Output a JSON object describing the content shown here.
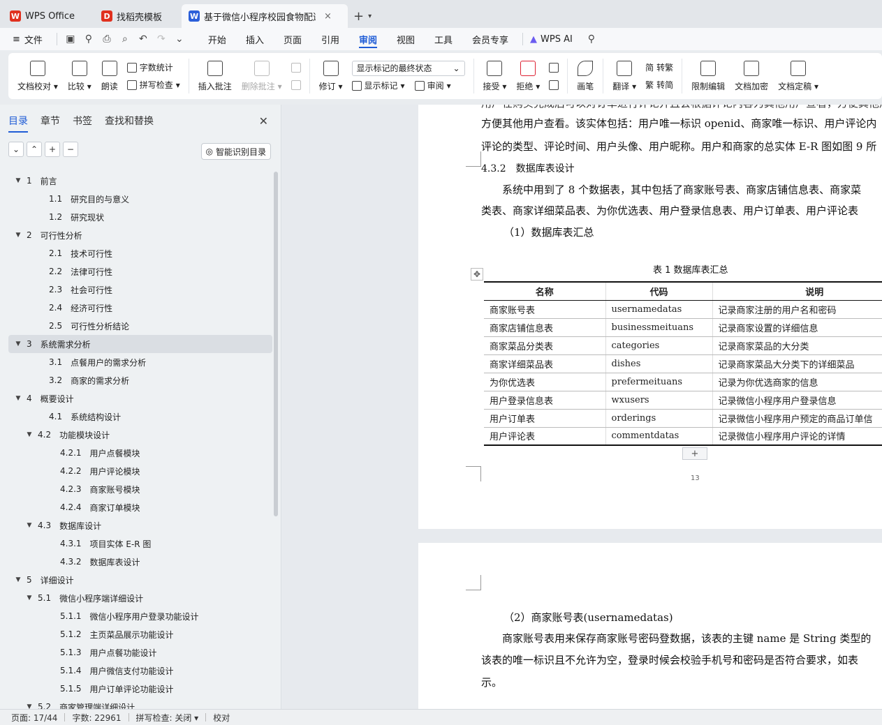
{
  "tabs": [
    {
      "label": "WPS Office",
      "logo": "W",
      "color": "#e0301e"
    },
    {
      "label": "找稻壳模板",
      "logo": "D",
      "color": "#e0301e"
    },
    {
      "label": "基于微信小程序校园食物配送",
      "logo": "W",
      "color": "#2b5fd9",
      "close": "×"
    }
  ],
  "tab_add": "+",
  "menu": {
    "file": "文件",
    "items": [
      "开始",
      "插入",
      "页面",
      "引用",
      "审阅",
      "视图",
      "工具",
      "会员专享"
    ],
    "active": "审阅",
    "wps_ai": "WPS AI"
  },
  "ribbon": {
    "doc_check": "文档校对",
    "compare": "比较",
    "read_aloud": "朗读",
    "word_count": "字数统计",
    "spell_check": "拼写检查",
    "insert_comment": "插入批注",
    "delete_comment": "删除批注",
    "revise": "修订",
    "markup_select": "显示标记的最终状态",
    "show_markup": "显示标记",
    "review": "审阅",
    "accept": "接受",
    "reject": "拒绝",
    "pen": "画笔",
    "translate": "翻译",
    "to_traditional": "转繁",
    "to_simplified": "转简",
    "restrict_edit": "限制编辑",
    "encrypt": "文档加密",
    "finalize": "文档定稿"
  },
  "sidebar": {
    "tabs": [
      "目录",
      "章节",
      "书签",
      "查找和替换"
    ],
    "active_tab": "目录",
    "smart_toc": "智能识别目录",
    "toc": [
      {
        "num": "1",
        "text": "前言",
        "level": 1,
        "expanded": true
      },
      {
        "num": "1.1",
        "text": "研究目的与意义",
        "level": 2
      },
      {
        "num": "1.2",
        "text": "研究现状",
        "level": 2
      },
      {
        "num": "2",
        "text": "可行性分析",
        "level": 1,
        "expanded": true
      },
      {
        "num": "2.1",
        "text": "技术可行性",
        "level": 2
      },
      {
        "num": "2.2",
        "text": "法律可行性",
        "level": 2
      },
      {
        "num": "2.3",
        "text": "社会可行性",
        "level": 2
      },
      {
        "num": "2.4",
        "text": "经济可行性",
        "level": 2
      },
      {
        "num": "2.5",
        "text": "可行性分析结论",
        "level": 2
      },
      {
        "num": "3",
        "text": "系统需求分析",
        "level": 1,
        "expanded": true,
        "selected": true
      },
      {
        "num": "3.1",
        "text": "点餐用户的需求分析",
        "level": 2
      },
      {
        "num": "3.2",
        "text": "商家的需求分析",
        "level": 2
      },
      {
        "num": "4",
        "text": "概要设计",
        "level": 1,
        "expanded": true
      },
      {
        "num": "4.1",
        "text": "系统结构设计",
        "level": 2
      },
      {
        "num": "4.2",
        "text": "功能模块设计",
        "level": 2,
        "expanded": true
      },
      {
        "num": "4.2.1",
        "text": "用户点餐模块",
        "level": 3
      },
      {
        "num": "4.2.2",
        "text": "用户评论模块",
        "level": 3
      },
      {
        "num": "4.2.3",
        "text": "商家账号模块",
        "level": 3
      },
      {
        "num": "4.2.4",
        "text": "商家订单模块",
        "level": 3
      },
      {
        "num": "4.3",
        "text": "数据库设计",
        "level": 2,
        "expanded": true
      },
      {
        "num": "4.3.1",
        "text": "项目实体 E-R 图",
        "level": 3
      },
      {
        "num": "4.3.2",
        "text": "数据库表设计",
        "level": 3
      },
      {
        "num": "5",
        "text": "详细设计",
        "level": 1,
        "expanded": true
      },
      {
        "num": "5.1",
        "text": "微信小程序端详细设计",
        "level": 2,
        "expanded": true
      },
      {
        "num": "5.1.1",
        "text": "微信小程序用户登录功能设计",
        "level": 3
      },
      {
        "num": "5.1.2",
        "text": "主页菜品展示功能设计",
        "level": 3
      },
      {
        "num": "5.1.3",
        "text": "用户点餐功能设计",
        "level": 3
      },
      {
        "num": "5.1.4",
        "text": "用户微信支付功能设计",
        "level": 3
      },
      {
        "num": "5.1.5",
        "text": "用户订单评论功能设计",
        "level": 3
      },
      {
        "num": "5.2",
        "text": "商家管理端详细设计",
        "level": 2,
        "expanded": true
      }
    ]
  },
  "document": {
    "line_top": "用户在购买完成后可以对订单进行评论并且会根据评论内容为其他用户查看，方便其他用户查看。",
    "line1": "方便其他用户查看。该实体包括：用户唯一标识 openid、商家唯一标识、用户评论内",
    "line2": "评论的类型、评论时间、用户头像、用户昵称。用户和商家的总实体 E-R 图如图 9 所",
    "heading": "4.3.2　数据库表设计",
    "para1": "系统中用到了 8 个数据表，其中包括了商家账号表、商家店铺信息表、商家菜",
    "para2": "类表、商家详细菜品表、为你优选表、用户登录信息表、用户订单表、用户评论表",
    "sub1": "（1）数据库表汇总",
    "table_caption": "表 1  数据库表汇总",
    "table_headers": [
      "名称",
      "代码",
      "说明"
    ],
    "table_rows": [
      [
        "商家账号表",
        "usernamedatas",
        "记录商家注册的用户名和密码"
      ],
      [
        "商家店铺信息表",
        "businessmeituans",
        "记录商家设置的详细信息"
      ],
      [
        "商家菜品分类表",
        "categories",
        "记录商家菜品的大分类"
      ],
      [
        "商家详细菜品表",
        "dishes",
        "记录商家菜品大分类下的详细菜品"
      ],
      [
        "为你优选表",
        "prefermeituans",
        "记录为你优选商家的信息"
      ],
      [
        "用户登录信息表",
        "wxusers",
        "记录微信小程序用户登录信息"
      ],
      [
        "用户订单表",
        "orderings",
        "记录微信小程序用户预定的商品订单信"
      ],
      [
        "用户评论表",
        "commentdatas",
        "记录微信小程序用户评论的详情"
      ]
    ],
    "page_number": "13",
    "sub2": "（2）商家账号表(usernamedatas)",
    "para3": "商家账号表用来保存商家账号密码登数据，该表的主键 name 是 String 类型的",
    "para4": "该表的唯一标识且不允许为空，登录时候会校验手机号和密码是否符合要求，如表",
    "para5": "示。"
  },
  "status": {
    "page": "页面: 17/44",
    "words": "字数: 22961",
    "spell": "拼写检查: 关闭",
    "proof": "校对"
  }
}
